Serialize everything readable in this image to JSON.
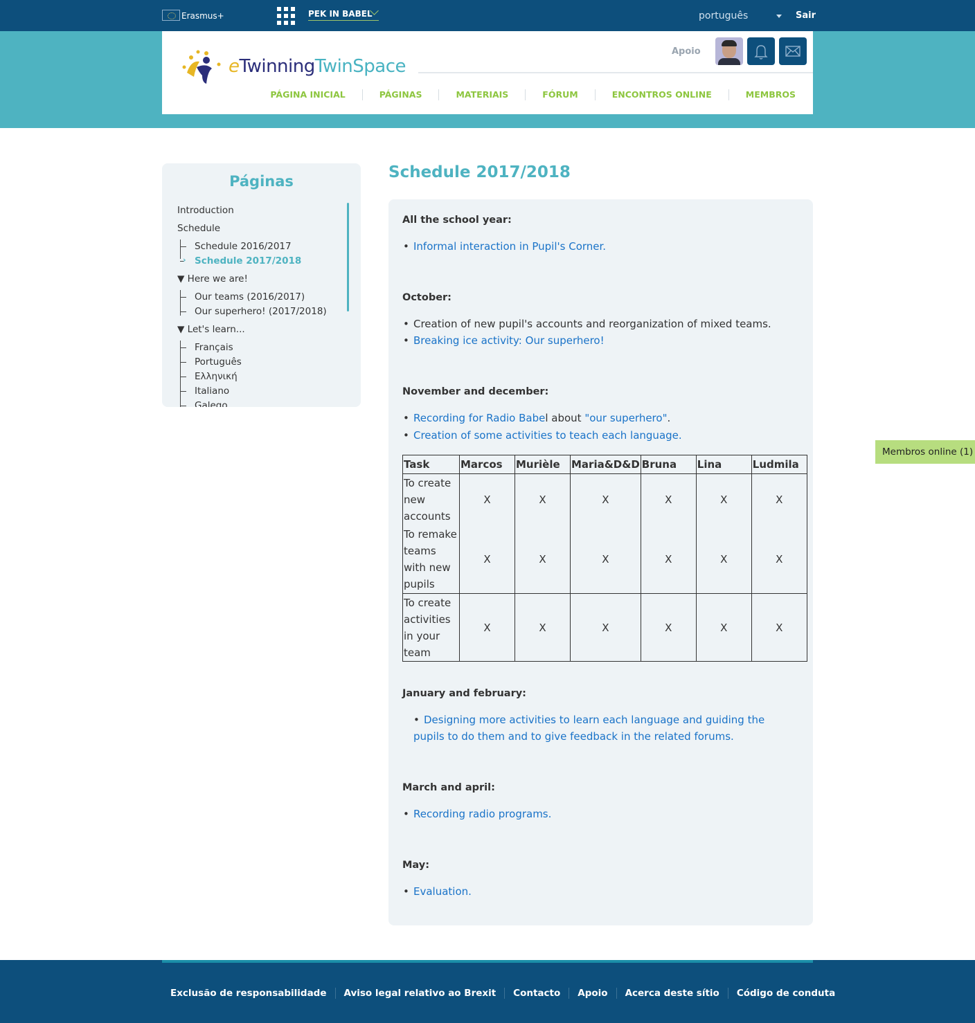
{
  "topbar": {
    "erasmus_label": "Erasmus+",
    "project_name": "PEK IN BABEL",
    "language": "português",
    "logout": "Sair"
  },
  "header": {
    "logo_e": "e",
    "logo_twinning": "Twinning",
    "logo_twinspace": "TwinSpace",
    "support": "Apoio",
    "nav": [
      "PÁGINA INICIAL",
      "PÁGINAS",
      "MATERIAIS",
      "FÓRUM",
      "ENCONTROS ONLINE",
      "MEMBROS"
    ]
  },
  "sidebar": {
    "title": "Páginas",
    "items": {
      "introduction": "Introduction",
      "schedule": "Schedule",
      "schedule_1617": "Schedule 2016/2017",
      "schedule_1718": "Schedule 2017/2018",
      "here_we_are": "▼ Here we are!",
      "our_teams": "Our teams (2016/2017)",
      "our_superhero": "Our superhero! (2017/2018)",
      "lets_learn": "▼ Let's learn...",
      "francais": "Français",
      "portugues": "Português",
      "ellinika": "Ελληνική",
      "italiano": "Italiano",
      "galego": "Galego"
    }
  },
  "main": {
    "title": "Schedule 2017/2018",
    "s1_heading": "All the school year:",
    "s1_item1": "Informal interaction in Pupil's Corner.",
    "s2_heading": "October:",
    "s2_item1": "Creation of new pupil's accounts and reorganization of mixed teams.",
    "s2_item2": "Breaking ice activity: Our superhero!",
    "s3_heading": "November and december:",
    "s3_item1_a": "Recording for Radio Babe",
    "s3_item1_b": "l about ",
    "s3_item1_c": "\"our superhero\"",
    "s3_item1_d": ".",
    "s3_item2": "Creation of some activities to teach each language.",
    "table": {
      "headers": [
        "Task",
        "Marcos",
        "Murièle",
        "Maria&D&D",
        "Bruna",
        "Lina",
        "Ludmila"
      ],
      "rows": [
        {
          "task": "To create new accounts",
          "cells": [
            "X",
            "X",
            "X",
            "X",
            "X",
            "X"
          ]
        },
        {
          "task": "To remake teams with new pupils",
          "cells": [
            "X",
            "X",
            "X",
            "X",
            "X",
            "X"
          ]
        },
        {
          "task": "To create activities in your team",
          "cells": [
            "X",
            "X",
            "X",
            "X",
            "X",
            "X"
          ]
        }
      ]
    },
    "s4_heading": "January and february:",
    "s4_item1": "Designing more activities to learn each language and guiding the pupils to do them and to give feedback in the related forums.",
    "s5_heading": "March and april:",
    "s5_item1": "Recording radio programs.",
    "s6_heading": "May:",
    "s6_item1": "Evaluation."
  },
  "online_members": "Membros online (1)",
  "footer": {
    "links": [
      "Exclusão de responsabilidade",
      "Aviso legal relativo ao Brexit",
      "Contacto",
      "Apoio",
      "Acerca deste sítio",
      "Código de conduta"
    ]
  },
  "colors": {
    "dark_blue": "#0d4f7c",
    "teal": "#4eb3c1",
    "green": "#8dc63f",
    "link_blue": "#1a73c8",
    "panel": "#eef3f6"
  }
}
